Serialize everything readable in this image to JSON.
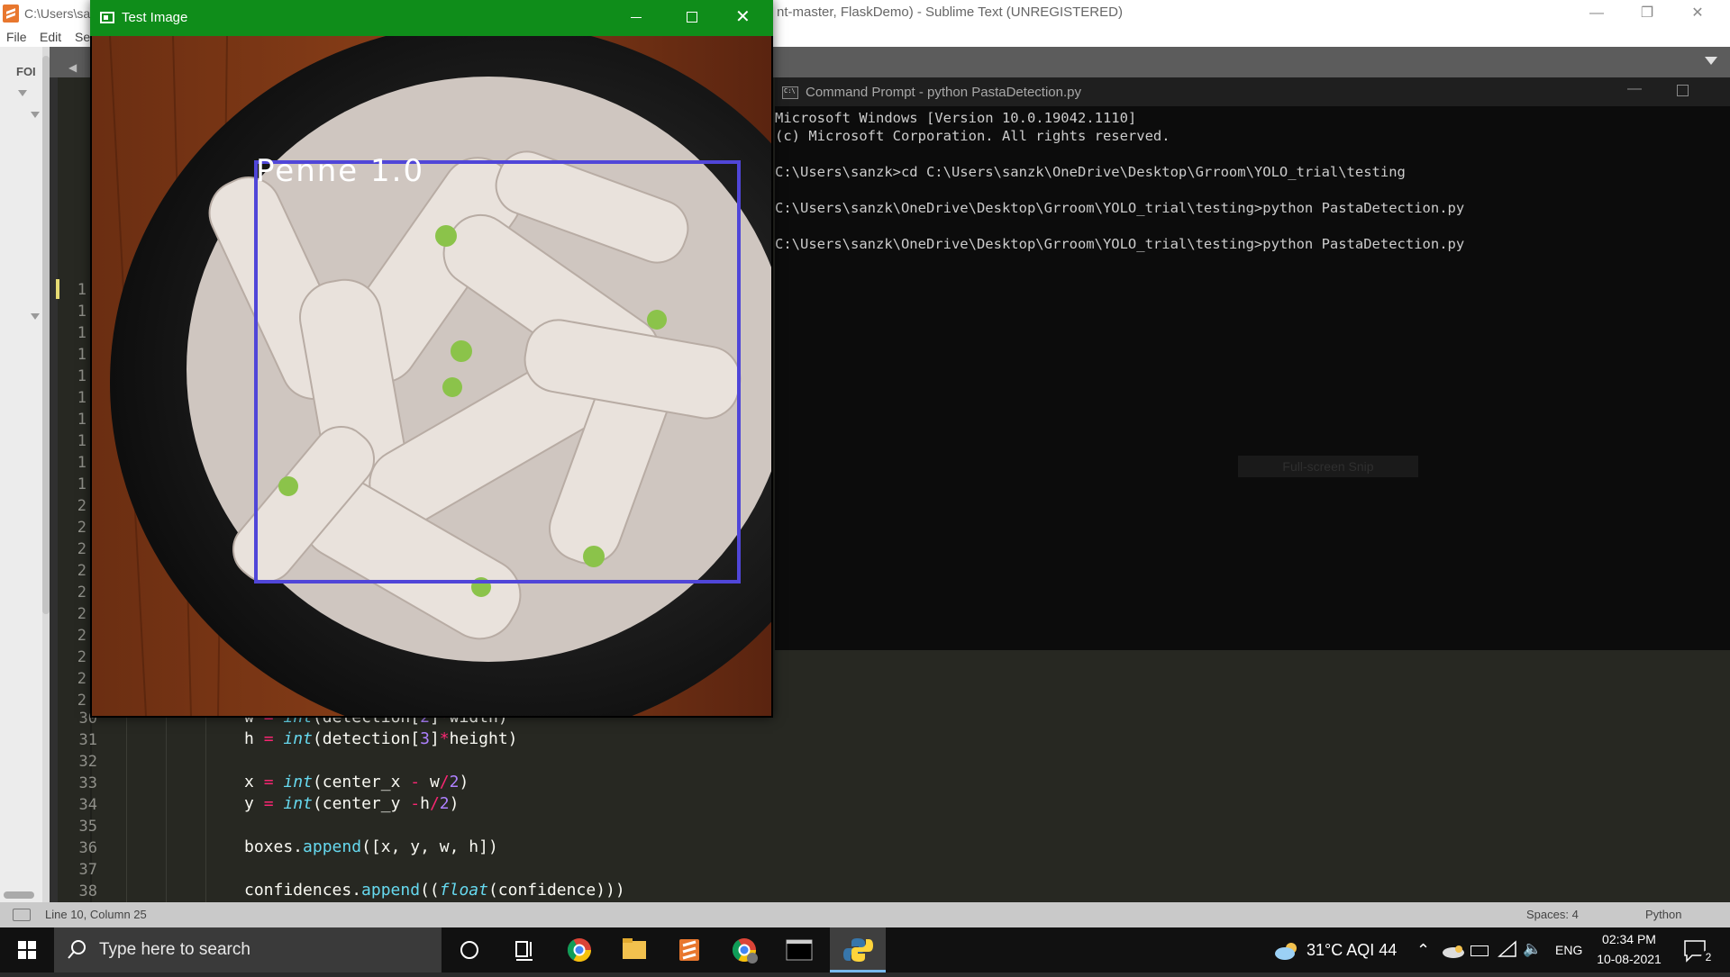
{
  "sublime": {
    "title_left": "C:\\Users\\sa",
    "title_right": "nt-master, FlaskDemo) - Sublime Text (UNREGISTERED)",
    "menu": [
      "File",
      "Edit",
      "Se"
    ],
    "sidebar_label": "FOI",
    "partial_line_numbers": [
      "1",
      "1",
      "1",
      "1",
      "1",
      "1",
      "1",
      "1",
      "1",
      "1",
      "2",
      "2",
      "2",
      "2",
      "2",
      "2",
      "2",
      "2",
      "2",
      "2"
    ],
    "code_lines": [
      {
        "no": "30",
        "text": "w = int(detection[2]*width)"
      },
      {
        "no": "31",
        "text": "h = int(detection[3]*height)"
      },
      {
        "no": "32",
        "text": ""
      },
      {
        "no": "33",
        "text": "x = int(center_x - w/2)"
      },
      {
        "no": "34",
        "text": "y = int(center_y -h/2)"
      },
      {
        "no": "35",
        "text": ""
      },
      {
        "no": "36",
        "text": "boxes.append([x, y, w, h])"
      },
      {
        "no": "37",
        "text": ""
      },
      {
        "no": "38",
        "text": "confidences.append((float(confidence)))"
      }
    ],
    "status": {
      "position": "Line 10, Column 25",
      "spaces": "Spaces: 4",
      "syntax": "Python"
    }
  },
  "cmd": {
    "title": "Command Prompt - python  PastaDetection.py",
    "lines": [
      "Microsoft Windows [Version 10.0.19042.1110]",
      "(c) Microsoft Corporation. All rights reserved.",
      "",
      "C:\\Users\\sanzk>cd C:\\Users\\sanzk\\OneDrive\\Desktop\\Grroom\\YOLO_trial\\testing",
      "",
      "C:\\Users\\sanzk\\OneDrive\\Desktop\\Grroom\\YOLO_trial\\testing>python PastaDetection.py",
      "",
      "C:\\Users\\sanzk\\OneDrive\\Desktop\\Grroom\\YOLO_trial\\testing>python PastaDetection.py"
    ],
    "snip_overlay": "Full-screen Snip"
  },
  "test_window": {
    "title": "Test Image",
    "detection_label": "Penne 1.0",
    "box_color": "#5046d8"
  },
  "taskbar": {
    "search_placeholder": "Type here to search",
    "weather": "31°C  AQI 44",
    "language": "ENG",
    "time": "02:34 PM",
    "date": "10-08-2021",
    "notification_count": "2"
  }
}
